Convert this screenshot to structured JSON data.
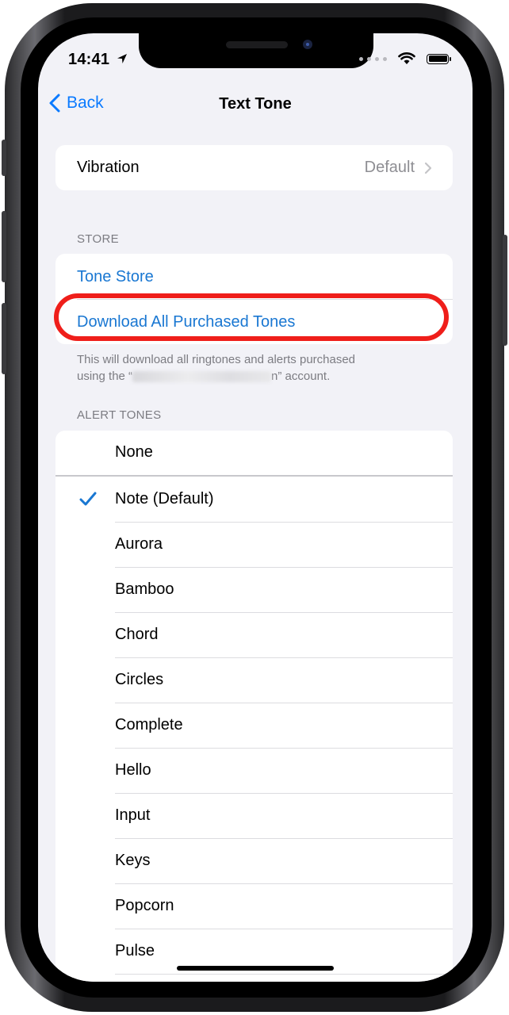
{
  "status_bar": {
    "time": "14:41"
  },
  "nav": {
    "back_label": "Back",
    "title": "Text Tone"
  },
  "vibration": {
    "label": "Vibration",
    "value": "Default"
  },
  "store": {
    "header": "STORE",
    "tone_store_label": "Tone Store",
    "download_label": "Download All Purchased Tones",
    "footnote_line1": "This will download all ringtones and alerts purchased",
    "footnote_prefix": "using the “",
    "footnote_suffix": "n” account."
  },
  "alert_tones": {
    "header": "ALERT TONES",
    "items": [
      {
        "label": "None",
        "selected": false
      },
      {
        "label": "Note (Default)",
        "selected": true
      },
      {
        "label": "Aurora",
        "selected": false
      },
      {
        "label": "Bamboo",
        "selected": false
      },
      {
        "label": "Chord",
        "selected": false
      },
      {
        "label": "Circles",
        "selected": false
      },
      {
        "label": "Complete",
        "selected": false
      },
      {
        "label": "Hello",
        "selected": false
      },
      {
        "label": "Input",
        "selected": false
      },
      {
        "label": "Keys",
        "selected": false
      },
      {
        "label": "Popcorn",
        "selected": false
      },
      {
        "label": "Pulse",
        "selected": false
      }
    ]
  },
  "colors": {
    "accent": "#1977d2",
    "highlight_ring": "#ef1e1a",
    "background": "#f2f2f7"
  }
}
